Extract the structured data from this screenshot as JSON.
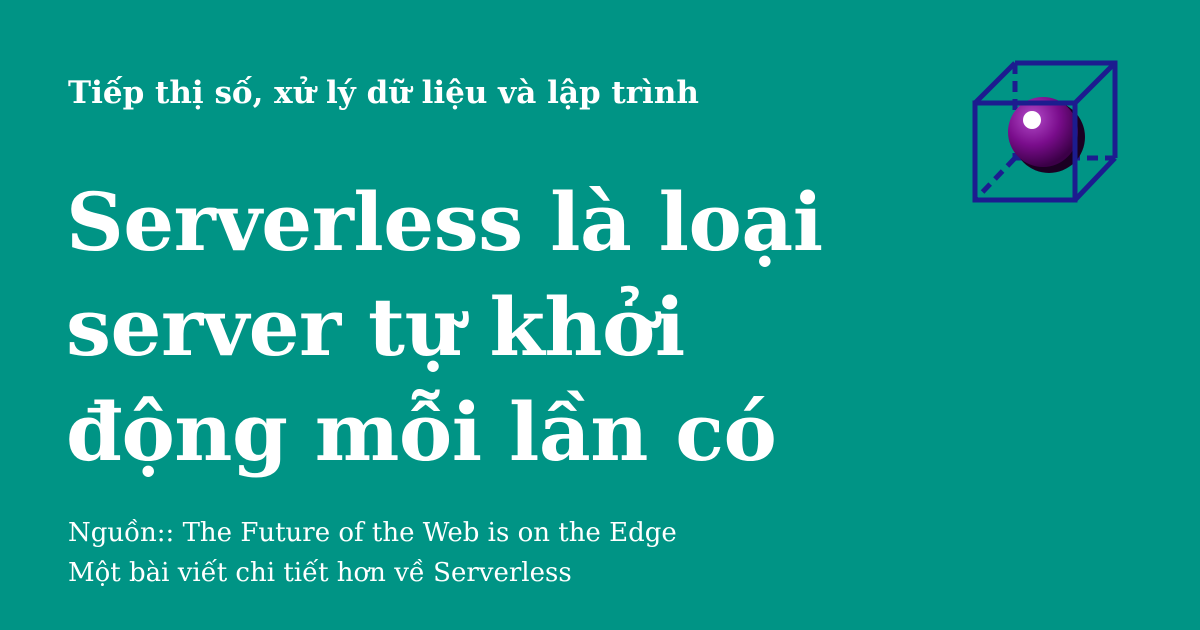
{
  "tagline": "Tiếp thị số, xử lý dữ liệu và lập trình",
  "headline": {
    "lines": [
      "Serverless là loại",
      "server tự khởi",
      "động mỗi lần có"
    ]
  },
  "footer": {
    "source": "Nguồn:: The Future of the Web is on the Edge",
    "article": "Một bài viết chi tiết hơn về Serverless"
  },
  "logo": {
    "icon": "cube-sphere-icon"
  },
  "colors": {
    "background": "#009485",
    "text": "#ffffff",
    "cube": "#1c1c8f",
    "sphere": "#7a0d8c"
  }
}
